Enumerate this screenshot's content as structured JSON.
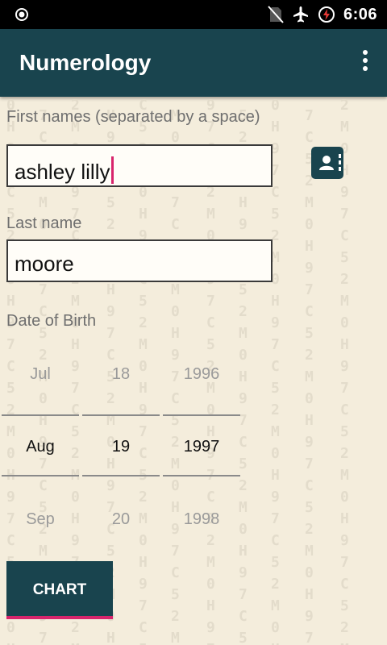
{
  "status_bar": {
    "time": "6:06"
  },
  "app_bar": {
    "title": "Numerology"
  },
  "form": {
    "first_names_label": "First names (separated by a space)",
    "first_names_value": "ashley lilly",
    "last_name_label": "Last name",
    "last_name_value": "moore",
    "dob_label": "Date of Birth"
  },
  "date_picker": {
    "month": {
      "prev": "Jul",
      "selected": "Aug",
      "next": "Sep"
    },
    "day": {
      "prev": "18",
      "selected": "19",
      "next": "20"
    },
    "year": {
      "prev": "1996",
      "selected": "1997",
      "next": "1998"
    }
  },
  "chart_button": {
    "label": "CHART"
  }
}
